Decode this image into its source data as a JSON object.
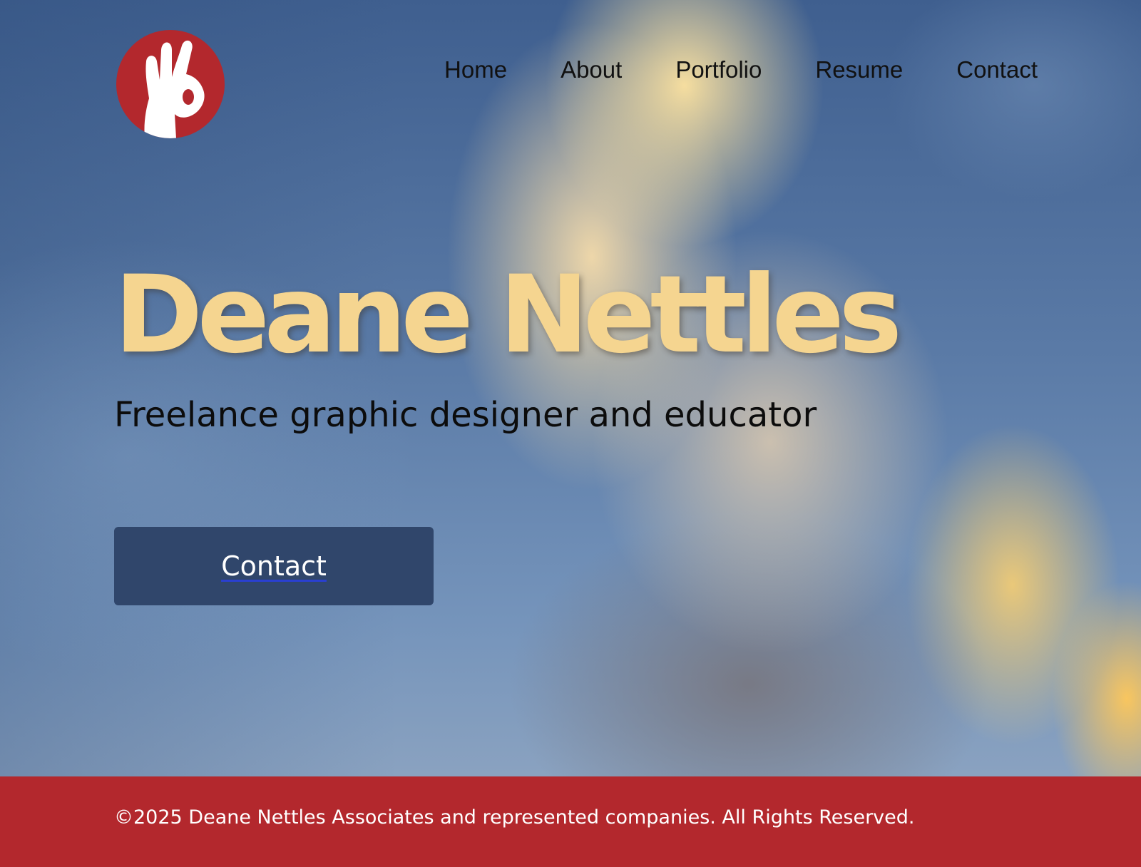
{
  "logo": {
    "icon": "ok-hand-icon",
    "background_color": "#b3282d"
  },
  "nav": {
    "items": [
      {
        "label": "Home"
      },
      {
        "label": "About"
      },
      {
        "label": "Portfolio"
      },
      {
        "label": "Resume"
      },
      {
        "label": "Contact"
      }
    ]
  },
  "hero": {
    "title": "Deane Nettles",
    "subtitle": "Freelance graphic designer and educator",
    "cta_label": "Contact",
    "title_color": "#f5d590",
    "button_color": "#30466b"
  },
  "footer": {
    "text": "©2025 Deane Nettles Associates and represented companies. All Rights Reserved.",
    "background_color": "#b3282d"
  }
}
